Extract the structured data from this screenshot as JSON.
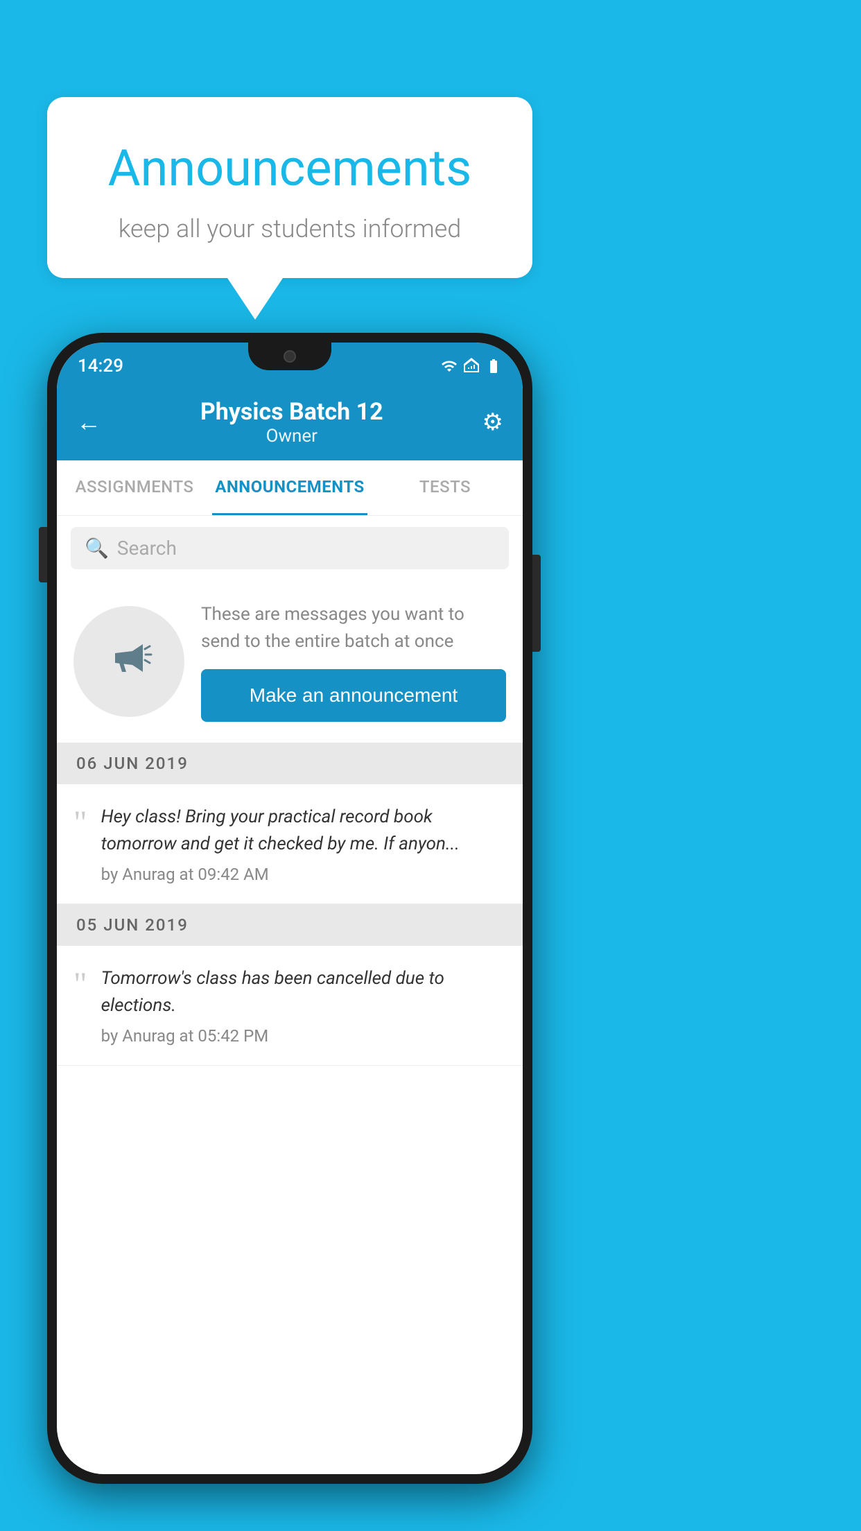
{
  "background_color": "#1ab8e8",
  "speech_bubble": {
    "title": "Announcements",
    "subtitle": "keep all your students informed"
  },
  "phone": {
    "status_bar": {
      "time": "14:29",
      "icons": [
        "wifi",
        "signal",
        "battery"
      ]
    },
    "app_bar": {
      "title": "Physics Batch 12",
      "subtitle": "Owner",
      "back_label": "←",
      "gear_label": "⚙"
    },
    "tabs": [
      {
        "label": "ASSIGNMENTS",
        "active": false
      },
      {
        "label": "ANNOUNCEMENTS",
        "active": true
      },
      {
        "label": "TESTS",
        "active": false
      }
    ],
    "search": {
      "placeholder": "Search"
    },
    "promo": {
      "description": "These are messages you want to send to the entire batch at once",
      "button_label": "Make an announcement"
    },
    "announcement_groups": [
      {
        "date": "06  JUN  2019",
        "items": [
          {
            "text": "Hey class! Bring your practical record book tomorrow and get it checked by me. If anyon...",
            "author": "by Anurag at 09:42 AM"
          }
        ]
      },
      {
        "date": "05  JUN  2019",
        "items": [
          {
            "text": "Tomorrow's class has been cancelled due to elections.",
            "author": "by Anurag at 05:42 PM"
          }
        ]
      }
    ]
  }
}
